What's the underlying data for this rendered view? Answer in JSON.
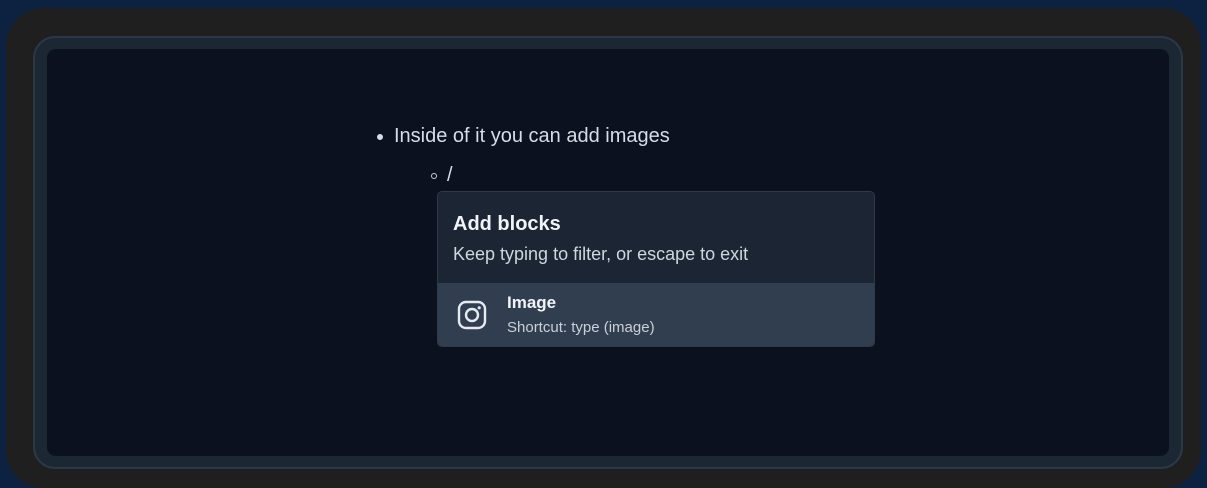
{
  "editor": {
    "bullet_text": "Inside of it you can add images",
    "sub_bullet_text": "/"
  },
  "block_menu": {
    "title": "Add blocks",
    "subtitle": "Keep typing to filter, or escape to exit",
    "items": [
      {
        "label": "Image",
        "hint": "Shortcut: type (image)",
        "icon": "image-icon"
      }
    ]
  }
}
